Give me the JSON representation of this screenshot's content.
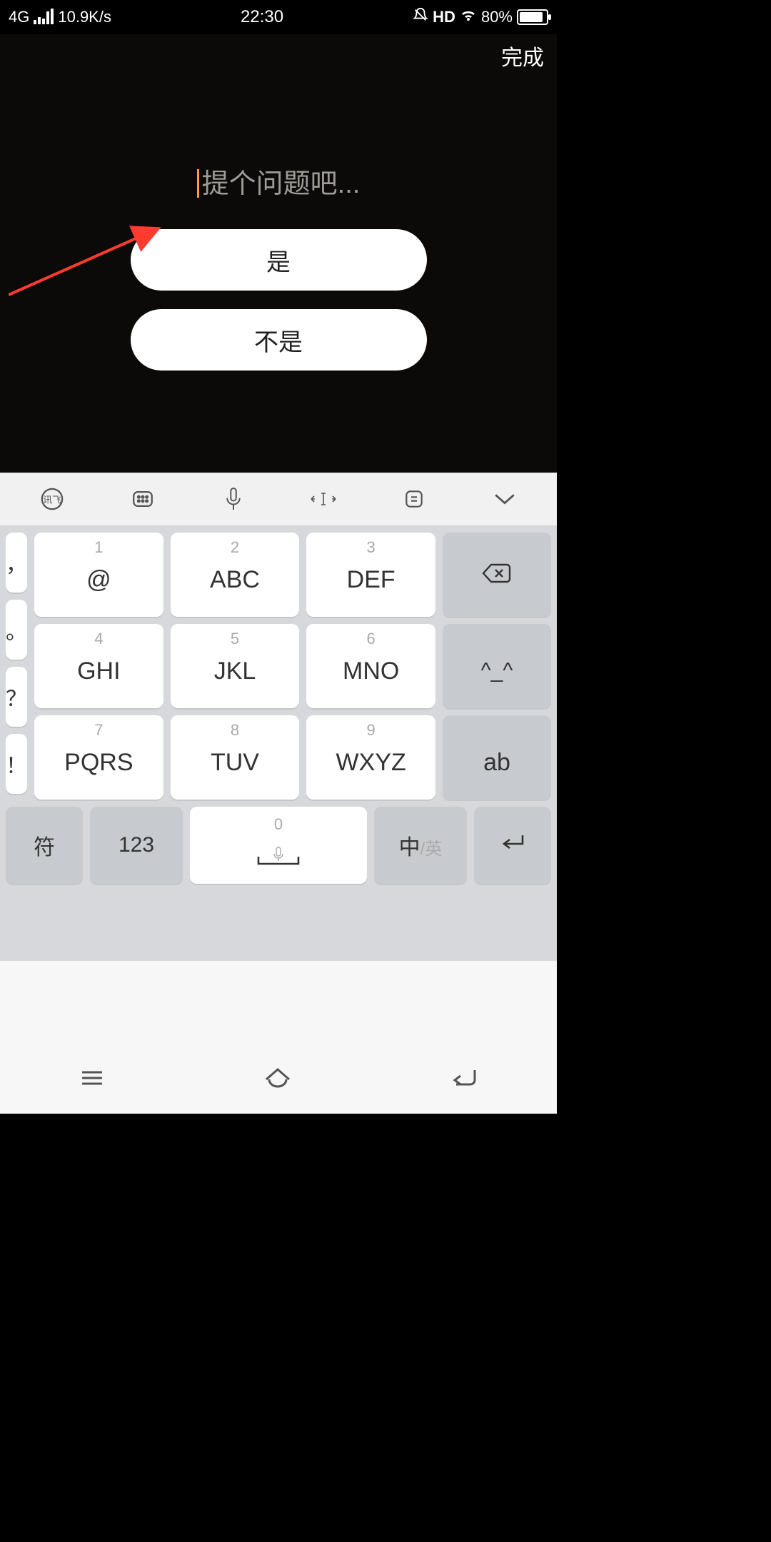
{
  "statusbar": {
    "network_type": "4G",
    "speed": "10.9K/s",
    "time": "22:30",
    "hd": "HD",
    "battery_pct": "80%"
  },
  "header": {
    "done": "完成"
  },
  "question": {
    "placeholder": "提个问题吧...",
    "option_yes": "是",
    "option_no": "不是"
  },
  "keyboard": {
    "left": {
      "comma": "，",
      "dot": "。",
      "question": "？",
      "exclaim": "！"
    },
    "keys": {
      "k1": {
        "num": "1",
        "letters": "@"
      },
      "k2": {
        "num": "2",
        "letters": "ABC"
      },
      "k3": {
        "num": "3",
        "letters": "DEF"
      },
      "k4": {
        "num": "4",
        "letters": "GHI"
      },
      "k5": {
        "num": "5",
        "letters": "JKL"
      },
      "k6": {
        "num": "6",
        "letters": "MNO"
      },
      "k7": {
        "num": "7",
        "letters": "PQRS"
      },
      "k8": {
        "num": "8",
        "letters": "TUV"
      },
      "k9": {
        "num": "9",
        "letters": "WXYZ"
      },
      "face": "^_^",
      "ab": "ab"
    },
    "bottom": {
      "symbol": "符",
      "numeric": "123",
      "space_num": "0",
      "lang_main": "中",
      "lang_sub": "/英"
    }
  }
}
